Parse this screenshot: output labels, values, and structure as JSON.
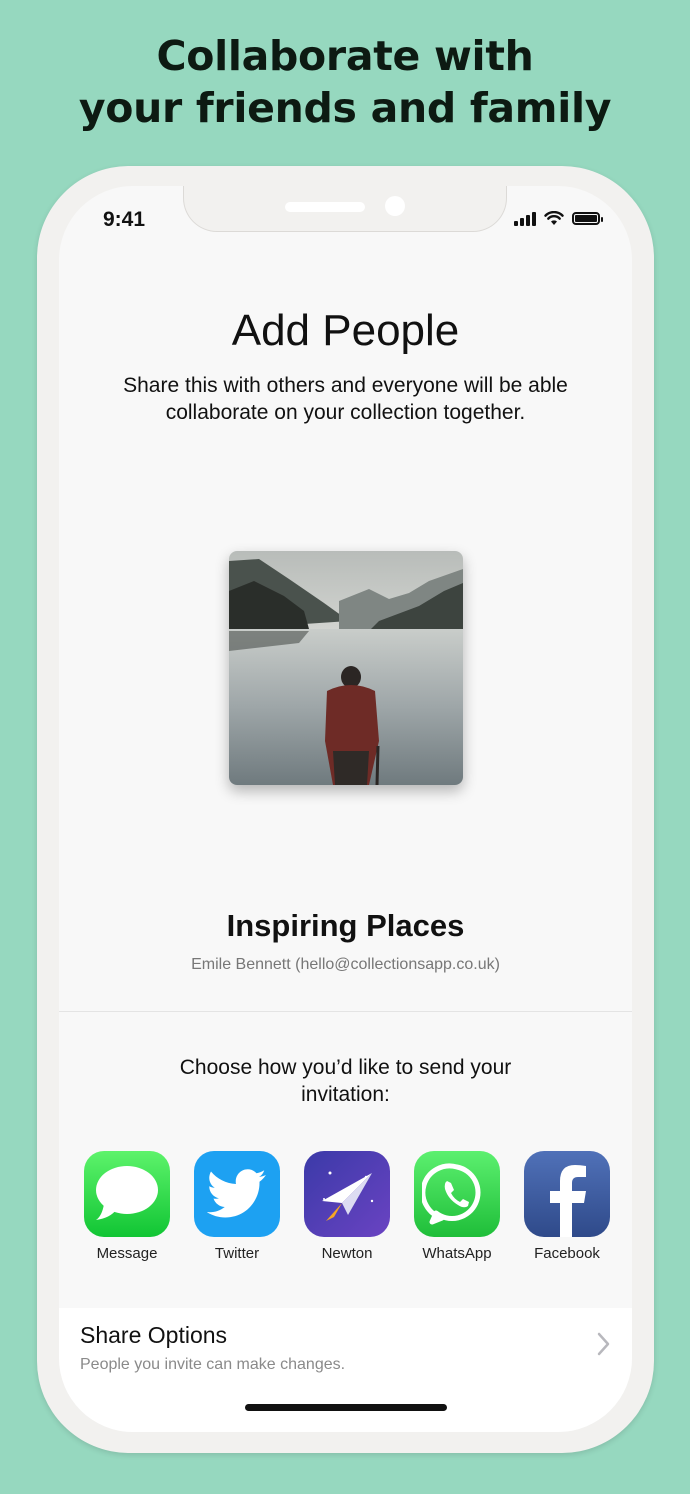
{
  "headline": {
    "line1": "Collaborate with",
    "line2": "your friends and family"
  },
  "status_bar": {
    "time": "9:41",
    "icons": [
      "signal-icon",
      "wifi-icon",
      "battery-icon"
    ]
  },
  "add_people": {
    "title": "Add People",
    "subtitle_line1": "Share this with others and everyone will be able",
    "subtitle_line2": "collaborate on your collection together."
  },
  "collection": {
    "name": "Inspiring Places",
    "owner": "Emile Bennett (hello@collectionsapp.co.uk)",
    "cover_image": "person-standing-in-mountain-lake"
  },
  "invite": {
    "prompt_line1": "Choose how you’d like to send your",
    "prompt_line2": "invitation:",
    "apps": [
      {
        "label": "Message",
        "icon": "message-icon",
        "color": "#2ecc4a"
      },
      {
        "label": "Twitter",
        "icon": "twitter-icon",
        "color": "#1da1f2"
      },
      {
        "label": "Newton",
        "icon": "newton-icon",
        "color": "#4b3fb0"
      },
      {
        "label": "WhatsApp",
        "icon": "whatsapp-icon",
        "color": "#25c23f"
      },
      {
        "label": "Facebook",
        "icon": "facebook-icon",
        "color": "#3b5998"
      }
    ]
  },
  "share_options": {
    "title": "Share Options",
    "subtitle": "People you invite can make changes."
  },
  "colors": {
    "background": "#96d8bf",
    "screen": "#f8f8f8",
    "frame": "#f2f1ef"
  }
}
